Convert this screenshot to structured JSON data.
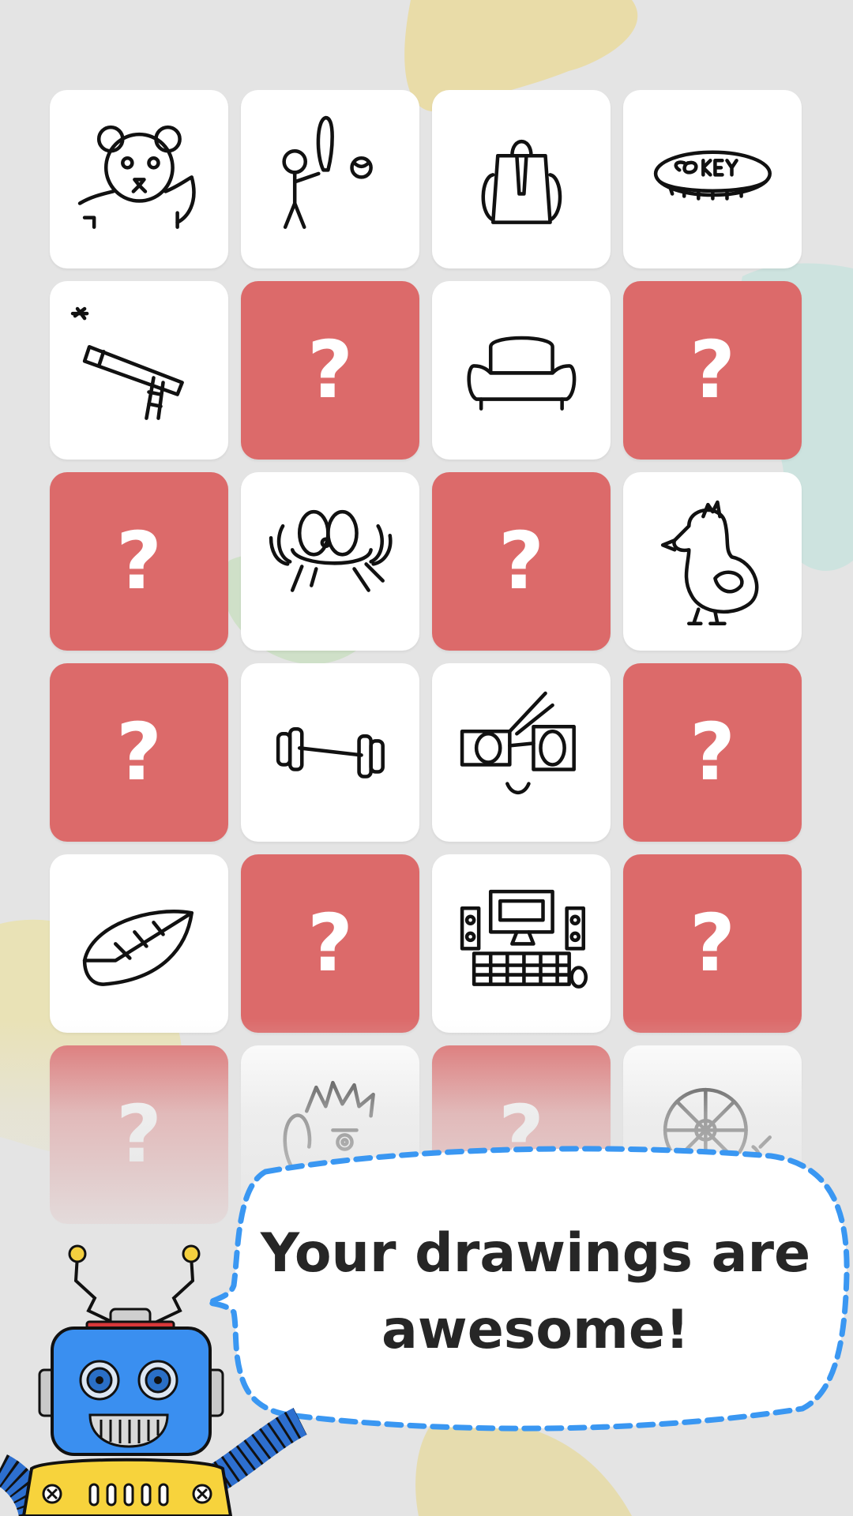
{
  "board": {
    "rows": [
      [
        {
          "state": "revealed",
          "icon": "bear-drawing-icon"
        },
        {
          "state": "revealed",
          "icon": "baseball-player-drawing-icon"
        },
        {
          "state": "revealed",
          "icon": "backpack-drawing-icon"
        },
        {
          "state": "revealed",
          "icon": "coke-can-drawing-icon"
        }
      ],
      [
        {
          "state": "revealed",
          "icon": "telescope-drawing-icon"
        },
        {
          "state": "hidden",
          "label": "?"
        },
        {
          "state": "revealed",
          "icon": "couch-drawing-icon"
        },
        {
          "state": "hidden",
          "label": "?"
        }
      ],
      [
        {
          "state": "hidden",
          "label": "?"
        },
        {
          "state": "revealed",
          "icon": "crab-drawing-icon"
        },
        {
          "state": "hidden",
          "label": "?"
        },
        {
          "state": "revealed",
          "icon": "chicken-drawing-icon"
        }
      ],
      [
        {
          "state": "hidden",
          "label": "?"
        },
        {
          "state": "revealed",
          "icon": "dumbbell-drawing-icon"
        },
        {
          "state": "revealed",
          "icon": "eyeglasses-drawing-icon"
        },
        {
          "state": "hidden",
          "label": "?"
        }
      ],
      [
        {
          "state": "revealed",
          "icon": "leaf-drawing-icon"
        },
        {
          "state": "hidden",
          "label": "?"
        },
        {
          "state": "revealed",
          "icon": "computer-drawing-icon"
        },
        {
          "state": "hidden",
          "label": "?"
        }
      ],
      [
        {
          "state": "hidden",
          "label": "?"
        },
        {
          "state": "revealed",
          "icon": "face-drawing-icon"
        },
        {
          "state": "hidden",
          "label": "?"
        },
        {
          "state": "revealed",
          "icon": "fan-drawing-icon"
        }
      ]
    ]
  },
  "speech_bubble": {
    "text": "Your drawings are\nawesome!"
  },
  "mascot": {
    "icon": "robot-mascot-icon"
  },
  "colors": {
    "hidden_tile": "#dc6a6a",
    "revealed_tile": "#ffffff",
    "background": "#e4e4e4",
    "bubble_border": "#3a97f2",
    "robot_body": "#3a8ff0",
    "robot_base": "#f7d33c"
  }
}
